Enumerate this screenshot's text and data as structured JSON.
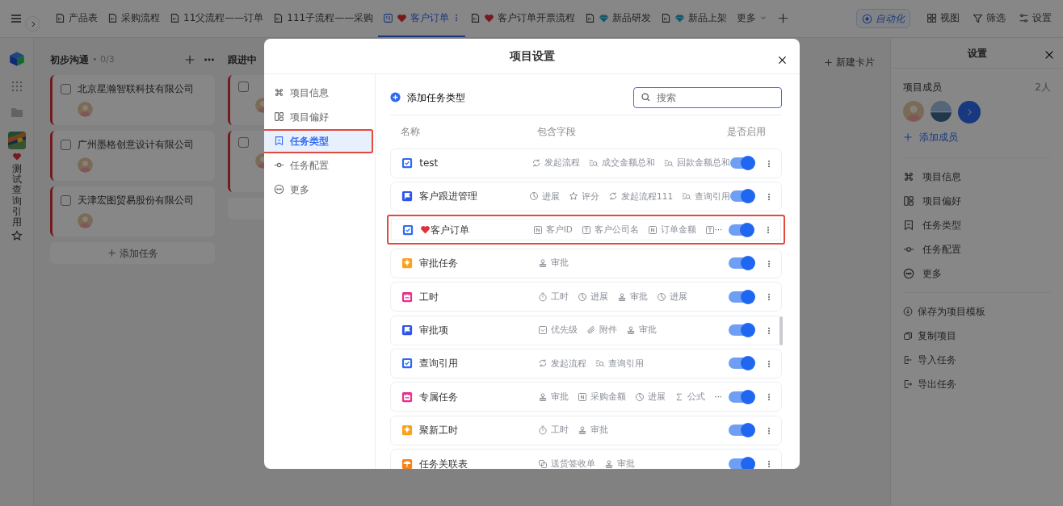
{
  "topbar": {
    "tabs": [
      {
        "label": "产品表",
        "selected": false
      },
      {
        "label": "采购流程",
        "selected": false
      },
      {
        "label": "11父流程——订单",
        "selected": false
      },
      {
        "label": "111子流程——采购",
        "selected": false
      },
      {
        "label": "客户订单",
        "heart": true,
        "selected": true
      },
      {
        "label": "客户订单开票流程",
        "heart": true,
        "selected": false
      },
      {
        "label": "新品研发",
        "gem": true,
        "selected": false
      },
      {
        "label": "新品上架",
        "gem": true,
        "selected": false
      }
    ],
    "more_tabs": "更多",
    "actions": [
      {
        "kind": "automation",
        "label": "自动化"
      },
      {
        "kind": "grid",
        "label": "视图"
      },
      {
        "kind": "filter",
        "label": "筛选"
      },
      {
        "kind": "sliders",
        "label": "设置"
      }
    ]
  },
  "rail": {
    "project_name": "测试查询引用",
    "favorite": false
  },
  "board": {
    "columns": [
      {
        "title": "初步沟通",
        "count": "• 0/3",
        "cards": [
          {
            "title": "北京星瀚智联科技有限公司",
            "checked": false
          },
          {
            "title": "广州墨格创意设计有限公司",
            "checked": false
          },
          {
            "title": "天津宏图贸易股份有限公司",
            "checked": false
          }
        ],
        "add_label": "添加任务"
      },
      {
        "title": "跟进中",
        "cards": [
          {
            "kind": "covered",
            "checked": false
          },
          {
            "kind": "covered_tall",
            "checked": false
          }
        ],
        "add_bar": true
      }
    ],
    "new_card_label": "新建卡片"
  },
  "modal": {
    "title": "项目设置",
    "nav": [
      {
        "kind": "command",
        "label": "项目信息",
        "selected": false,
        "highlighted": false
      },
      {
        "kind": "layout",
        "label": "项目偏好",
        "selected": false,
        "highlighted": false
      },
      {
        "kind": "bookmark",
        "label": "任务类型",
        "selected": true,
        "highlighted": true
      },
      {
        "kind": "node",
        "label": "任务配置",
        "selected": false,
        "highlighted": false
      },
      {
        "kind": "more",
        "label": "更多",
        "selected": false,
        "highlighted": false
      }
    ],
    "add_type_label": "添加任务类型",
    "search": {
      "placeholder": "搜索"
    },
    "columns": [
      "名称",
      "包含字段",
      "是否启用"
    ],
    "rows": [
      {
        "kind": "checkbox",
        "name": "test",
        "enabled": true,
        "highlighted": false,
        "fields": [
          {
            "kind": "flow",
            "label": "发起流程"
          },
          {
            "kind": "lookup",
            "label": "成交金额总和"
          },
          {
            "kind": "lookup",
            "label": "回款金额总和"
          }
        ]
      },
      {
        "kind": "flag",
        "name": "客户跟进管理",
        "enabled": true,
        "highlighted": false,
        "fields": [
          {
            "kind": "progress",
            "label": "进展"
          },
          {
            "kind": "star",
            "label": "评分"
          },
          {
            "kind": "flow",
            "label": "发起流程111"
          },
          {
            "kind": "lookup",
            "label": "查询引用"
          }
        ]
      },
      {
        "kind": "checkbox",
        "name": "客户订单",
        "heart": true,
        "enabled": true,
        "highlighted": true,
        "more": "···",
        "fields": [
          {
            "kind": "number",
            "label": "客户ID"
          },
          {
            "kind": "text",
            "label": "客户公司名"
          },
          {
            "kind": "number",
            "label": "订单金额"
          },
          {
            "kind": "text"
          }
        ]
      },
      {
        "kind": "bulb",
        "name": "审批任务",
        "enabled": true,
        "highlighted": false,
        "fields": [
          {
            "kind": "approval",
            "label": "审批"
          }
        ]
      },
      {
        "kind": "calendar",
        "name": "工时",
        "enabled": true,
        "highlighted": false,
        "fields": [
          {
            "kind": "timer",
            "label": "工时"
          },
          {
            "kind": "progress",
            "label": "进展"
          },
          {
            "kind": "approval",
            "label": "审批"
          },
          {
            "kind": "progress",
            "label": "进展"
          }
        ]
      },
      {
        "kind": "flag",
        "name": "审批项",
        "enabled": true,
        "highlighted": false,
        "fields": [
          {
            "kind": "priority",
            "label": "优先级"
          },
          {
            "kind": "attachment",
            "label": "附件"
          },
          {
            "kind": "approval",
            "label": "审批"
          }
        ]
      },
      {
        "kind": "checkbox",
        "name": "查询引用",
        "enabled": true,
        "highlighted": false,
        "fields": [
          {
            "kind": "flow",
            "label": "发起流程"
          },
          {
            "kind": "lookup",
            "label": "查询引用"
          }
        ]
      },
      {
        "kind": "calendar",
        "name": "专属任务",
        "enabled": true,
        "highlighted": false,
        "more": "···",
        "fields": [
          {
            "kind": "approval",
            "label": "审批"
          },
          {
            "kind": "number",
            "label": "采购金额"
          },
          {
            "kind": "progress",
            "label": "进展"
          },
          {
            "kind": "formula",
            "label": "公式"
          }
        ]
      },
      {
        "kind": "bulb",
        "name": "聚新工时",
        "enabled": true,
        "highlighted": false,
        "fields": [
          {
            "kind": "timer",
            "label": "工时"
          },
          {
            "kind": "approval",
            "label": "审批"
          }
        ]
      },
      {
        "kind": "umbrella",
        "name": "任务关联表",
        "enabled": true,
        "highlighted": false,
        "fields": [
          {
            "kind": "doc",
            "label": "送货签收单"
          },
          {
            "kind": "approval",
            "label": "审批"
          }
        ]
      }
    ]
  },
  "settings_panel": {
    "title": "设置",
    "members_label": "项目成员",
    "members_count": "2人",
    "add_member_label": "添加成员",
    "menu": [
      {
        "kind": "command",
        "label": "项目信息"
      },
      {
        "kind": "layout",
        "label": "项目偏好"
      },
      {
        "kind": "bookmark",
        "label": "任务类型"
      },
      {
        "kind": "node",
        "label": "任务配置"
      },
      {
        "kind": "more",
        "label": "更多"
      }
    ],
    "actions": [
      {
        "kind": "download",
        "label": "保存为项目模板"
      },
      {
        "kind": "copy",
        "label": "复制项目"
      },
      {
        "kind": "import",
        "label": "导入任务"
      },
      {
        "kind": "export",
        "label": "导出任务"
      }
    ]
  }
}
